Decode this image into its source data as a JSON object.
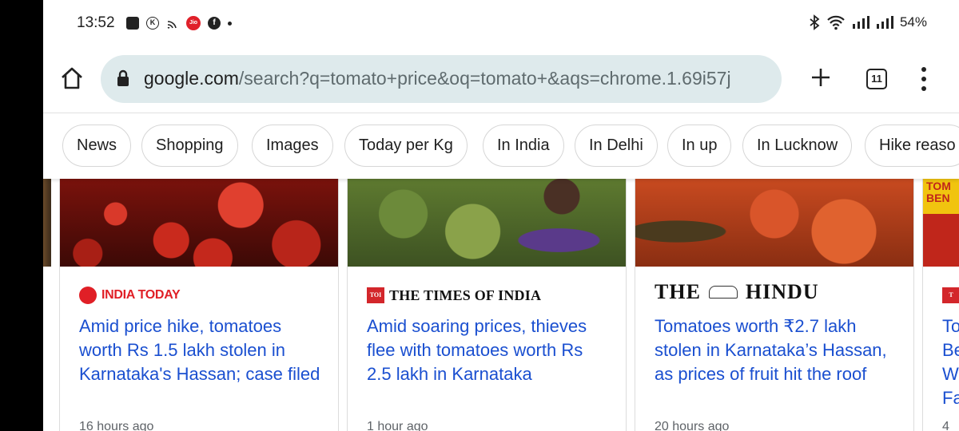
{
  "status_bar": {
    "time": "13:52",
    "icons": [
      "notes-icon",
      "k-app-icon",
      "cast-icon",
      "jio-icon",
      "facebook-icon"
    ],
    "jio_label": "Jio",
    "k_label": "K",
    "fb_label": "f",
    "battery": "54%"
  },
  "browser": {
    "url_host": "google.com",
    "url_rest": "/search?q=tomato+price&oq=tomato+&aqs=chrome.1.69i57j",
    "tab_count": "11"
  },
  "chips": [
    "News",
    "Shopping",
    "Images",
    "Today per Kg",
    "In India",
    "In Delhi",
    "In up",
    "In Lucknow",
    "Hike reaso"
  ],
  "news": [
    {
      "source": "INDIA TODAY",
      "logo_text": "INDIA TODAY",
      "headline": "Amid price hike, tomatoes worth Rs 1.5 lakh stolen in Karnataka's Hassan; case filed",
      "age": "16 hours ago"
    },
    {
      "source": "THE TIMES OF INDIA",
      "logo_text": "TOI",
      "headline": "Amid soaring prices, thieves flee with tomatoes worth Rs 2.5 lakh in Karnataka",
      "age": "1 hour ago"
    },
    {
      "source_left": "THE",
      "source_right": "HINDU",
      "headline": "Tomatoes worth ₹2.7 lakh stolen in Karnataka’s Hassan, as prices of fruit hit the roof",
      "age": "20 hours ago"
    },
    {
      "source_logo": "T",
      "headline_lines": [
        "To",
        "Be",
        "W",
        "Fa"
      ],
      "age": "4",
      "thumb_text": "TOM BEN"
    }
  ],
  "colors": {
    "link": "#1a4fd0",
    "india_today_red": "#e01f26",
    "omnibox_bg": "#deeaec"
  }
}
